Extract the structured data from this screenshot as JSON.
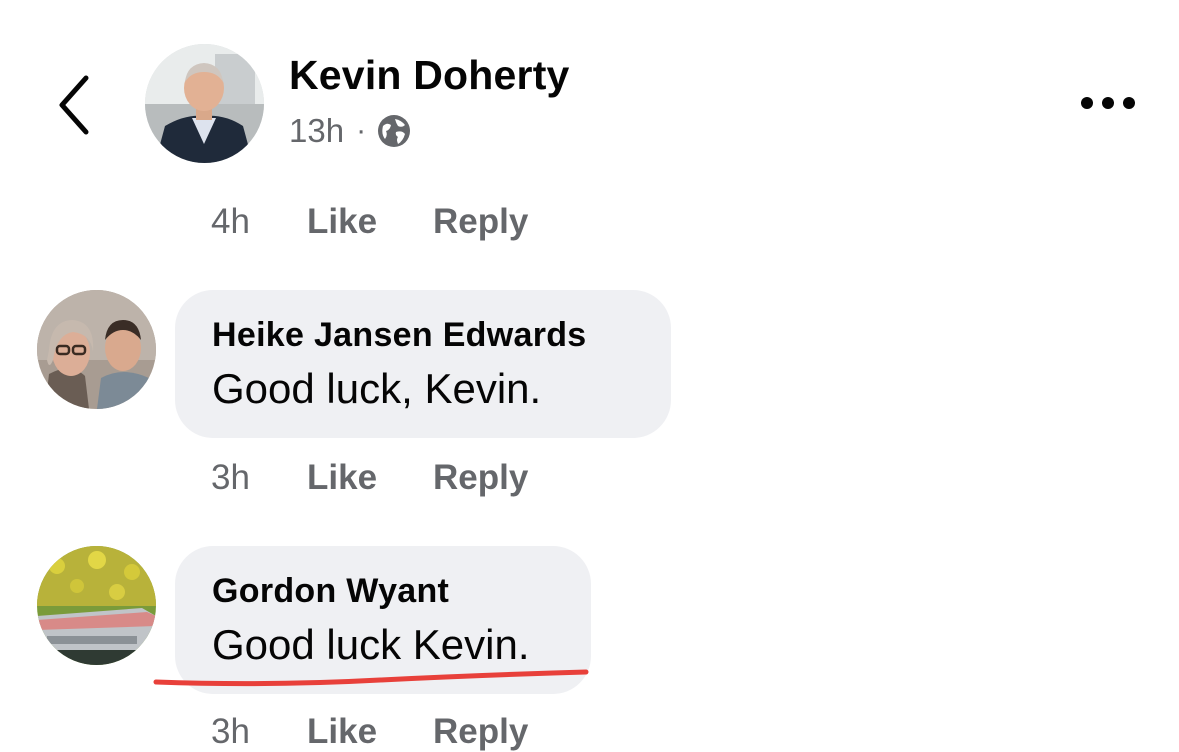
{
  "post_header": {
    "author": "Kevin Doherty",
    "time": "13h",
    "separator": "·",
    "privacy_icon": "globe-icon",
    "back_icon": "chevron-left-icon",
    "more_icon": "more-horizontal-icon"
  },
  "thread": {
    "top_actions": {
      "time": "4h",
      "like": "Like",
      "reply": "Reply"
    },
    "comments": [
      {
        "author": "Heike Jansen Edwards",
        "text": "Good luck, Kevin.",
        "time": "3h",
        "like": "Like",
        "reply": "Reply"
      },
      {
        "author": "Gordon Wyant",
        "text": "Good luck Kevin.",
        "time": "3h",
        "like": "Like",
        "reply": "Reply"
      }
    ]
  },
  "colors": {
    "text_primary": "#050505",
    "text_secondary": "#65676b",
    "bubble_bg": "#eff0f3",
    "annotation_underline": "#e8403a"
  }
}
